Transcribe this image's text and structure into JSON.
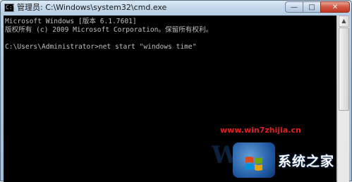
{
  "window": {
    "title": "管理员: C:\\Windows\\system32\\cmd.exe",
    "icon_glyph": "C:\\",
    "buttons": {
      "minimize": "—",
      "maximize": "□",
      "close": "✕"
    }
  },
  "console": {
    "lines": [
      "Microsoft Windows [版本 6.1.7601]",
      "版权所有 (c) 2009 Microsoft Corporation。保留所有权利。",
      "",
      "C:\\Users\\Administrator>net start \"windows time\""
    ]
  },
  "watermark": {
    "url": "www.win7zhijia.cn",
    "site_name": "系统之家",
    "big_letter": "W"
  },
  "colors": {
    "console_bg": "#000000",
    "console_fg": "#c0c0c0",
    "watermark_url": "#e02020",
    "close_button": "#c13b26"
  }
}
